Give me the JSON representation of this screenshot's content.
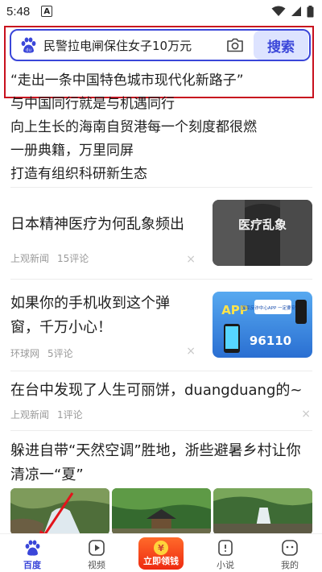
{
  "status_bar": {
    "time": "5:48",
    "notification_icon": "A"
  },
  "search": {
    "query": "民警拉电闸保住女子10万元",
    "button_label": "搜索"
  },
  "hot_list": [
    "“走出一条中国特色城市现代化新路子”",
    "与中国同行就是与机遇同行",
    "向上生长的海南自贸港每一个刻度都很燃",
    "一册典籍，万里同屏",
    "打造有组织科研新生态"
  ],
  "news": [
    {
      "title": "日本精神医疗为何乱象频出",
      "source": "上观新闻",
      "comments": "15评论",
      "thumb_text": "医疗乱象"
    },
    {
      "title": "如果你的手机收到这个弹窗，千万小心！",
      "source": "环球网",
      "comments": "5评论",
      "thumb_text_app": "APP",
      "thumb_text_number": "96110",
      "thumb_caption": "国家反诈中心APP 一定要安装！"
    },
    {
      "title": "在台中发现了人生可丽饼，duangduang的~",
      "source": "上观新闻",
      "comments": "1评论"
    },
    {
      "title": "躲进自带“天然空调”胜地，浙些避暑乡村让你清凉一“夏”"
    }
  ],
  "close_glyph": "×",
  "bottom_nav": {
    "items": [
      {
        "label": "百度",
        "icon": "baidu-paw-icon"
      },
      {
        "label": "视频",
        "icon": "play-icon"
      },
      {
        "label": "立即领钱",
        "icon": "coin-icon"
      },
      {
        "label": "小说",
        "icon": "book-icon"
      },
      {
        "label": "我的",
        "icon": "face-icon"
      }
    ]
  },
  "colors": {
    "accent": "#3a46d9",
    "highlight_red": "#c8101e",
    "coin_red": "#ee2a10"
  }
}
